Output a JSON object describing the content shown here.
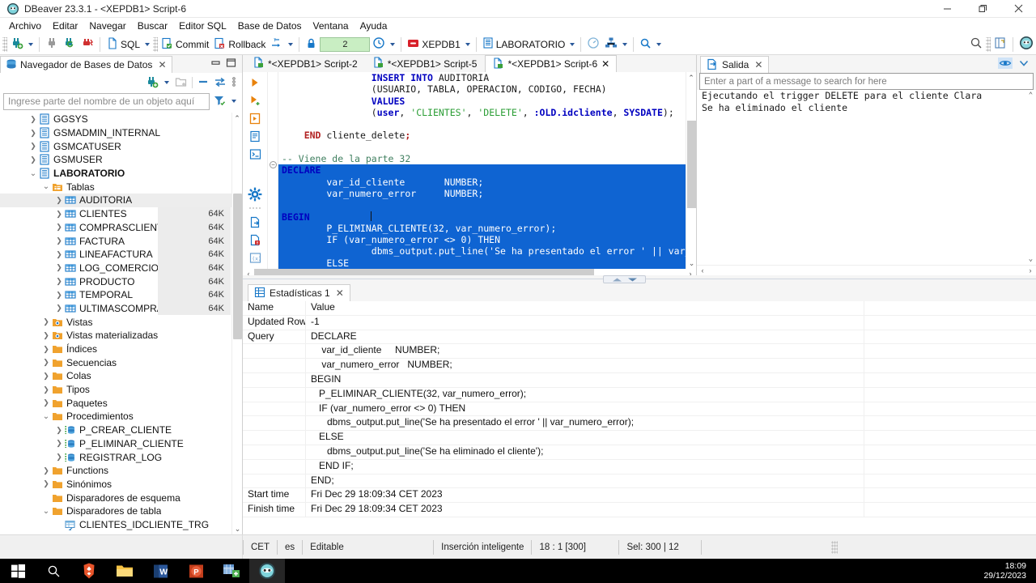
{
  "window": {
    "title": "DBeaver 23.3.1 - <XEPDB1> Script-6",
    "minimize": "—",
    "maximize": "❐",
    "close": "✕"
  },
  "menu": [
    {
      "label": "Archivo"
    },
    {
      "label": "Editar"
    },
    {
      "label": "Navegar"
    },
    {
      "label": "Buscar"
    },
    {
      "label": "Editor SQL"
    },
    {
      "label": "Base de Datos"
    },
    {
      "label": "Ventana"
    },
    {
      "label": "Ayuda"
    }
  ],
  "toolbar": {
    "sql_label": "SQL",
    "commit_label": "Commit",
    "rollback_label": "Rollback",
    "transaction_count": "2",
    "connection_label": "XEPDB1",
    "schema_label": "LABORATORIO"
  },
  "navigator": {
    "tab_label": "Navegador de Bases de Datos",
    "close": "✕",
    "filter_placeholder": "Ingrese parte del nombre de un objeto aquí",
    "items": [
      {
        "label": "GGSYS",
        "indent": 1,
        "icon": "schema-icon",
        "arrow": "collapsed",
        "size": "",
        "selected": false,
        "bold": false
      },
      {
        "label": "GSMADMIN_INTERNAL",
        "indent": 1,
        "icon": "schema-icon",
        "arrow": "collapsed",
        "size": "",
        "selected": false,
        "bold": false
      },
      {
        "label": "GSMCATUSER",
        "indent": 1,
        "icon": "schema-icon",
        "arrow": "collapsed",
        "size": "",
        "selected": false,
        "bold": false
      },
      {
        "label": "GSMUSER",
        "indent": 1,
        "icon": "schema-icon",
        "arrow": "collapsed",
        "size": "",
        "selected": false,
        "bold": false
      },
      {
        "label": "LABORATORIO",
        "indent": 1,
        "icon": "schema-icon",
        "arrow": "expanded",
        "size": "",
        "selected": false,
        "bold": true
      },
      {
        "label": "Tablas",
        "indent": 2,
        "icon": "folder-tables-icon",
        "arrow": "expanded",
        "size": "",
        "selected": false,
        "bold": false
      },
      {
        "label": "AUDITORIA",
        "indent": 3,
        "icon": "table-icon",
        "arrow": "collapsed",
        "size": "",
        "selected": true,
        "bold": false
      },
      {
        "label": "CLIENTES",
        "indent": 3,
        "icon": "table-icon",
        "arrow": "collapsed",
        "size": "64K",
        "selected": false,
        "bold": false
      },
      {
        "label": "COMPRASCLIENTE",
        "indent": 3,
        "icon": "table-icon",
        "arrow": "collapsed",
        "size": "64K",
        "selected": false,
        "bold": false
      },
      {
        "label": "FACTURA",
        "indent": 3,
        "icon": "table-icon",
        "arrow": "collapsed",
        "size": "64K",
        "selected": false,
        "bold": false
      },
      {
        "label": "LINEAFACTURA",
        "indent": 3,
        "icon": "table-icon",
        "arrow": "collapsed",
        "size": "64K",
        "selected": false,
        "bold": false
      },
      {
        "label": "LOG_COMERCIO",
        "indent": 3,
        "icon": "table-icon",
        "arrow": "collapsed",
        "size": "64K",
        "selected": false,
        "bold": false
      },
      {
        "label": "PRODUCTO",
        "indent": 3,
        "icon": "table-icon",
        "arrow": "collapsed",
        "size": "64K",
        "selected": false,
        "bold": false
      },
      {
        "label": "TEMPORAL",
        "indent": 3,
        "icon": "table-icon",
        "arrow": "collapsed",
        "size": "64K",
        "selected": false,
        "bold": false
      },
      {
        "label": "ULTIMASCOMPRAS",
        "indent": 3,
        "icon": "table-icon",
        "arrow": "collapsed",
        "size": "64K",
        "selected": false,
        "bold": false
      },
      {
        "label": "Vistas",
        "indent": 2,
        "icon": "view-icon",
        "arrow": "collapsed",
        "size": "",
        "selected": false,
        "bold": false
      },
      {
        "label": "Vistas materializadas",
        "indent": 2,
        "icon": "view-icon",
        "arrow": "collapsed",
        "size": "",
        "selected": false,
        "bold": false
      },
      {
        "label": "Índices",
        "indent": 2,
        "icon": "folder-icon",
        "arrow": "collapsed",
        "size": "",
        "selected": false,
        "bold": false
      },
      {
        "label": "Secuencias",
        "indent": 2,
        "icon": "folder-icon",
        "arrow": "collapsed",
        "size": "",
        "selected": false,
        "bold": false
      },
      {
        "label": "Colas",
        "indent": 2,
        "icon": "folder-icon",
        "arrow": "collapsed",
        "size": "",
        "selected": false,
        "bold": false
      },
      {
        "label": "Tipos",
        "indent": 2,
        "icon": "folder-icon",
        "arrow": "collapsed",
        "size": "",
        "selected": false,
        "bold": false
      },
      {
        "label": "Paquetes",
        "indent": 2,
        "icon": "folder-icon",
        "arrow": "collapsed",
        "size": "",
        "selected": false,
        "bold": false
      },
      {
        "label": "Procedimientos",
        "indent": 2,
        "icon": "folder-icon",
        "arrow": "expanded",
        "size": "",
        "selected": false,
        "bold": false
      },
      {
        "label": "P_CREAR_CLIENTE",
        "indent": 3,
        "icon": "procedure-icon",
        "arrow": "collapsed",
        "size": "",
        "selected": false,
        "bold": false
      },
      {
        "label": "P_ELIMINAR_CLIENTE",
        "indent": 3,
        "icon": "procedure-icon",
        "arrow": "collapsed",
        "size": "",
        "selected": false,
        "bold": false
      },
      {
        "label": "REGISTRAR_LOG",
        "indent": 3,
        "icon": "procedure-icon",
        "arrow": "collapsed",
        "size": "",
        "selected": false,
        "bold": false
      },
      {
        "label": "Functions",
        "indent": 2,
        "icon": "folder-icon",
        "arrow": "collapsed",
        "size": "",
        "selected": false,
        "bold": false
      },
      {
        "label": "Sinónimos",
        "indent": 2,
        "icon": "folder-icon",
        "arrow": "collapsed",
        "size": "",
        "selected": false,
        "bold": false
      },
      {
        "label": "Disparadores de esquema",
        "indent": 2,
        "icon": "folder-icon",
        "arrow": "none",
        "size": "",
        "selected": false,
        "bold": false
      },
      {
        "label": "Disparadores de tabla",
        "indent": 2,
        "icon": "folder-icon",
        "arrow": "expanded",
        "size": "",
        "selected": false,
        "bold": false
      },
      {
        "label": "CLIENTES_IDCLIENTE_TRG",
        "indent": 3,
        "icon": "trigger-icon",
        "arrow": "none",
        "size": "",
        "selected": false,
        "bold": false
      }
    ]
  },
  "editor": {
    "tabs": [
      {
        "label": "*<XEPDB1> Script-2",
        "active": false,
        "closable": false
      },
      {
        "label": "*<XEPDB1> Script-5",
        "active": false,
        "closable": false
      },
      {
        "label": "*<XEPDB1> Script-6",
        "active": true,
        "closable": true
      }
    ],
    "tab_close": "✕",
    "lines": [
      {
        "indent": 4,
        "selected": false,
        "tokens": [
          {
            "t": "INSERT INTO ",
            "c": "kwb"
          },
          {
            "t": "AUDITORIA",
            "c": ""
          }
        ]
      },
      {
        "indent": 4,
        "selected": false,
        "tokens": [
          {
            "t": "(USUARIO, TABLA, OPERACION, CODIGO, FECHA)",
            "c": ""
          }
        ]
      },
      {
        "indent": 4,
        "selected": false,
        "tokens": [
          {
            "t": "VALUES",
            "c": "kwb"
          }
        ]
      },
      {
        "indent": 4,
        "selected": false,
        "tokens": [
          {
            "t": "(",
            "c": ""
          },
          {
            "t": "user",
            "c": "kwb"
          },
          {
            "t": ", ",
            "c": ""
          },
          {
            "t": "'CLIENTES'",
            "c": "str"
          },
          {
            "t": ", ",
            "c": ""
          },
          {
            "t": "'DELETE'",
            "c": "str"
          },
          {
            "t": ", ",
            "c": ""
          },
          {
            "t": ":OLD.idcliente",
            "c": "kwb"
          },
          {
            "t": ", ",
            "c": ""
          },
          {
            "t": "SYSDATE",
            "c": "kwb"
          },
          {
            "t": ");",
            "c": ""
          }
        ]
      },
      {
        "indent": 0,
        "selected": false,
        "tokens": []
      },
      {
        "indent": 1,
        "selected": false,
        "tokens": [
          {
            "t": "END ",
            "c": "kw2"
          },
          {
            "t": "cliente_delete",
            "c": ""
          },
          {
            "t": ";",
            "c": "kw2"
          }
        ]
      },
      {
        "indent": 0,
        "selected": false,
        "tokens": []
      },
      {
        "indent": 0,
        "selected": false,
        "tokens": [
          {
            "t": "-- Viene de la parte 32",
            "c": "cmt"
          }
        ]
      },
      {
        "indent": 0,
        "selected": true,
        "tokens": [
          {
            "t": "DECLARE",
            "c": "kwb"
          }
        ]
      },
      {
        "indent": 2,
        "selected": true,
        "tokens": [
          {
            "t": "var_id_cliente       NUMBER;",
            "c": ""
          }
        ]
      },
      {
        "indent": 2,
        "selected": true,
        "tokens": [
          {
            "t": "var_numero_error     NUMBER;",
            "c": ""
          }
        ]
      },
      {
        "indent": 0,
        "selected": true,
        "tokens": []
      },
      {
        "indent": 0,
        "selected": true,
        "tokens": [
          {
            "t": "BEGIN",
            "c": "kwb"
          }
        ]
      },
      {
        "indent": 2,
        "selected": true,
        "tokens": [
          {
            "t": "P_ELIMINAR_CLIENTE(32, var_numero_error);",
            "c": ""
          }
        ]
      },
      {
        "indent": 2,
        "selected": true,
        "tokens": [
          {
            "t": "IF (var_numero_error <> 0) THEN",
            "c": ""
          }
        ]
      },
      {
        "indent": 4,
        "selected": true,
        "tokens": [
          {
            "t": "dbms_output.put_line('Se ha presentado el error ' || var_numero",
            "c": ""
          }
        ]
      },
      {
        "indent": 2,
        "selected": true,
        "tokens": [
          {
            "t": "ELSE",
            "c": ""
          }
        ]
      }
    ]
  },
  "output": {
    "tab_label": "Salida",
    "tab_close": "✕",
    "search_placeholder": "Enter a part of a message to search for here",
    "lines": [
      "Ejecutando el trigger DELETE para el cliente Clara",
      "Se ha eliminado el cliente"
    ]
  },
  "statistics": {
    "tab_label": "Estadísticas 1",
    "tab_close": "✕",
    "columns": [
      "Name",
      "Value"
    ],
    "rows": [
      {
        "name": "Updated Rows",
        "value": "-1"
      },
      {
        "name": "Query",
        "value": "DECLARE"
      },
      {
        "name": "",
        "value": "    var_id_cliente     NUMBER;"
      },
      {
        "name": "",
        "value": "    var_numero_error   NUMBER;"
      },
      {
        "name": "",
        "value": "BEGIN"
      },
      {
        "name": "",
        "value": "   P_ELIMINAR_CLIENTE(32, var_numero_error);"
      },
      {
        "name": "",
        "value": "   IF (var_numero_error <> 0) THEN"
      },
      {
        "name": "",
        "value": "      dbms_output.put_line('Se ha presentado el error ' || var_numero_error);"
      },
      {
        "name": "",
        "value": "   ELSE"
      },
      {
        "name": "",
        "value": "      dbms_output.put_line('Se ha eliminado el cliente');"
      },
      {
        "name": "",
        "value": "   END IF;"
      },
      {
        "name": "",
        "value": "END;"
      },
      {
        "name": "Start time",
        "value": "Fri Dec 29 18:09:34 CET 2023"
      },
      {
        "name": "Finish time",
        "value": "Fri Dec 29 18:09:34 CET 2023"
      }
    ]
  },
  "statusbar": {
    "timezone": "CET",
    "language": "es",
    "editable": "Editable",
    "insert_mode": "Inserción inteligente",
    "position": "18 : 1 [300]",
    "selection": "Sel: 300 | 12"
  },
  "taskbar": {
    "time": "18:09",
    "date": "29/12/2023"
  }
}
